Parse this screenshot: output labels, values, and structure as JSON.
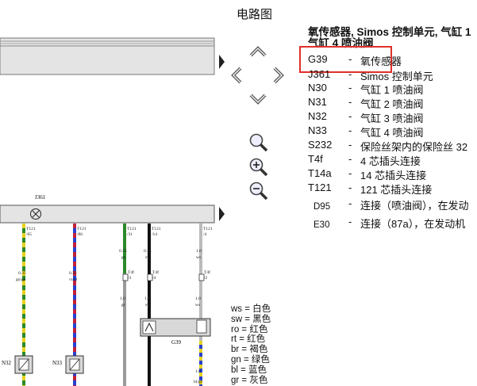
{
  "header": {
    "title": "电路图"
  },
  "legend": {
    "heading_line1": "氧传感器, Simos 控制单元, 气缸 1",
    "heading_line2": "气缸 4 喷油阀",
    "items": [
      {
        "code": "G39",
        "dash": "-",
        "desc": "氧传感器"
      },
      {
        "code": "J361",
        "dash": "-",
        "desc": "Simos 控制单元"
      },
      {
        "code": "N30",
        "dash": "-",
        "desc": "气缸 1 喷油阀"
      },
      {
        "code": "N31",
        "dash": "-",
        "desc": "气缸 2 喷油阀"
      },
      {
        "code": "N32",
        "dash": "-",
        "desc": "气缸 3 喷油阀"
      },
      {
        "code": "N33",
        "dash": "-",
        "desc": "气缸 4 喷油阀"
      },
      {
        "code": "S232",
        "dash": "-",
        "desc": "保险丝架内的保险丝 32"
      },
      {
        "code": "T4f",
        "dash": "-",
        "desc": "4 芯插头连接"
      },
      {
        "code": "T14a",
        "dash": "-",
        "desc": "14 芯插头连接"
      },
      {
        "code": "T121",
        "dash": "-",
        "desc": "121 芯插头连接"
      },
      {
        "code": "D95",
        "dash": "-",
        "desc": "连接（喷油阀），在发动"
      },
      {
        "code": "E30",
        "dash": "-",
        "desc": "连接（87a），在发动机"
      }
    ]
  },
  "color_codes": [
    "ws = 白色",
    "sw = 黑色",
    "ro = 红色",
    "rt = 红色",
    "br = 褐色",
    "gn = 绿色",
    "bl = 蓝色",
    "gr = 灰色"
  ],
  "diagram": {
    "unit_label": "J361",
    "wires": [
      {
        "pin": "T121\n/65",
        "size": "0.35",
        "color": "gn/ge"
      },
      {
        "pin": "T121\n/86",
        "size": "0.35",
        "color": "vi/bl"
      },
      {
        "pin": "T121\n/31",
        "size": "0.35",
        "color": "gn"
      },
      {
        "pin": "T121\n/14",
        "size": "0.35",
        "color": "sw"
      },
      {
        "pin": "T121\n/4",
        "size": "1.0",
        "color": "ws"
      }
    ],
    "connector_labels": [
      "T4f\n/3",
      "T4f\n/4",
      "T4f\n/2"
    ],
    "lower_labels": [
      {
        "size": "1.0",
        "color": "gr"
      },
      {
        "size": "1.0",
        "color": "sw"
      },
      {
        "size": "1.0",
        "color": "bl/ge"
      }
    ],
    "components": {
      "n32": "N32",
      "n33": "N33",
      "g39": "G39"
    }
  },
  "theme": {
    "highlight": "#e0302a",
    "wire_green": "#2a8a2a",
    "wire_yellow": "#e6d21e",
    "wire_blue": "#2640d0",
    "wire_red": "#c0203a"
  }
}
